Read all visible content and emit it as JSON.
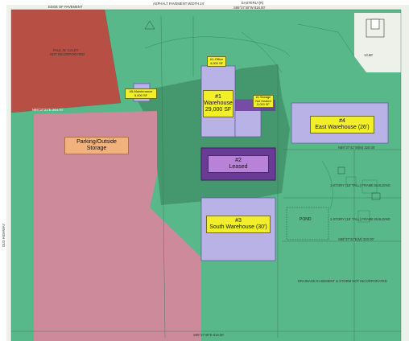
{
  "colors": {
    "site_green": "#58b889",
    "dark_green": "#3f8c66",
    "red_parcel": "#b74f45",
    "pink_parking": "#cc8a9b",
    "building_lavender": "#b9b2e6",
    "leased_purple": "#6a3b96",
    "label_yellow": "#f2ee2a",
    "parking_label_orange": "#f2b27e"
  },
  "buildings": {
    "warehouse1": {
      "number": "#1",
      "name": "Warehouse",
      "area": "29,000 SF"
    },
    "leased2": {
      "number": "#2",
      "name": "Leased"
    },
    "south3": {
      "number": "#3",
      "name": "South Warehouse (30')"
    },
    "east4": {
      "number": "#4",
      "name": "East Warehouse (26')"
    },
    "office1": {
      "line1": "#1-Office",
      "line2": "4,000 SF"
    },
    "storage1": {
      "line1": "#1 Storage",
      "line2": "Not Heated",
      "line3": "5,000 SF"
    },
    "maintenance5": {
      "line1": "#5-Maintenance",
      "line2": "5,000 SF"
    }
  },
  "parking": {
    "line1": "Parking/Outside",
    "line2": "Storage"
  },
  "annotations": {
    "top_road": "ASPHALT PAVEMENT WIDTH 24'",
    "top_bearing": "S89°37'40\"W  818.00'",
    "top_line": "EASTERLY(R)",
    "edge_pavement": "EDGE OF PAVEMENT",
    "red_parcel_owner": "PAUL W. CALEY",
    "red_parcel_owner2": "NOT INCORPORATED",
    "mid_bearing": "N89°37'21\"E  264.70'",
    "east_bearing": "N89°37'41\"W(M)  220.00'",
    "bottom_bearing": "S89°37'41\"E(M)  220.00'",
    "pond": "POND",
    "left_road": "OLD HIGHWAY",
    "right_dim": "13.60'",
    "bottom_bearing2": "S89°37'40\"E  818.00'",
    "drainage": "DRAINAGE EASEMENT & STORM NOT INCORPORATED",
    "shed1": "1-STORY (12' TALL) FRAME BUILDING",
    "shed2": "1-STORY (18' TALL) FRAME BUILDING"
  }
}
